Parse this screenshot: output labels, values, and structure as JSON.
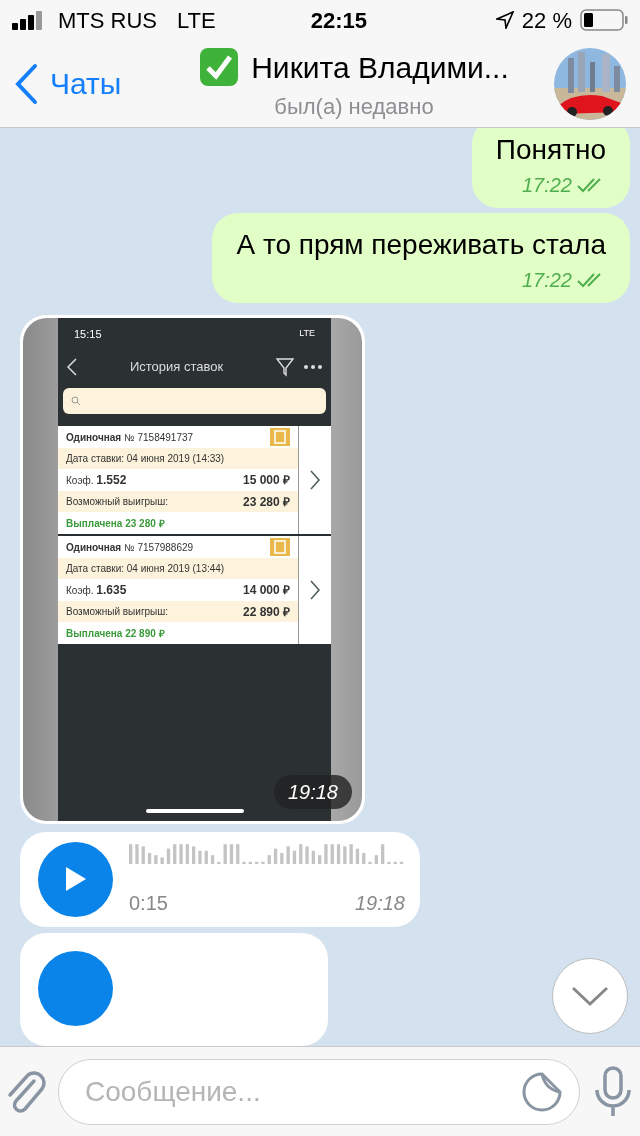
{
  "status_bar": {
    "carrier": "MTS RUS",
    "network": "LTE",
    "time": "22:15",
    "battery": "22 %"
  },
  "header": {
    "back": "Чаты",
    "title": "Никита Владими...",
    "verified": true,
    "subtitle": "был(а) недавно"
  },
  "messages": [
    {
      "kind": "text",
      "outgoing": true,
      "text": "Понятно",
      "time": "17:22",
      "read": true
    },
    {
      "kind": "text",
      "outgoing": true,
      "text": "А то прям переживать стала",
      "time": "17:22",
      "read": true
    },
    {
      "time": "19:18",
      "screenshot": {
        "status_time": "15:15",
        "status_network": "LTE",
        "title": "История ставок",
        "bets": [
          {
            "type": "Одиночная",
            "number": "№ 7158491737",
            "date": "Дата ставки: 04 июня 2019 (14:33)",
            "coef_label": "Коэф.",
            "coef": "1.552",
            "stake": "15 000 ₽",
            "win_label": "Возможный выигрыш:",
            "win": "23 280 ₽",
            "status": "Выплачена 23 280 ₽"
          },
          {
            "type": "Одиночная",
            "number": "№ 7157988629",
            "date": "Дата ставки: 04 июня 2019 (13:44)",
            "coef_label": "Коэф.",
            "coef": "1.635",
            "stake": "14 000 ₽",
            "win_label": "Возможный выигрыш:",
            "win": "22 890 ₽",
            "status": "Выплачена 22 890 ₽"
          }
        ]
      }
    },
    {
      "kind": "voice",
      "duration": "0:15",
      "time": "19:18"
    },
    {
      "kind": "voice_partial"
    }
  ],
  "input": {
    "placeholder": "Сообщение..."
  }
}
